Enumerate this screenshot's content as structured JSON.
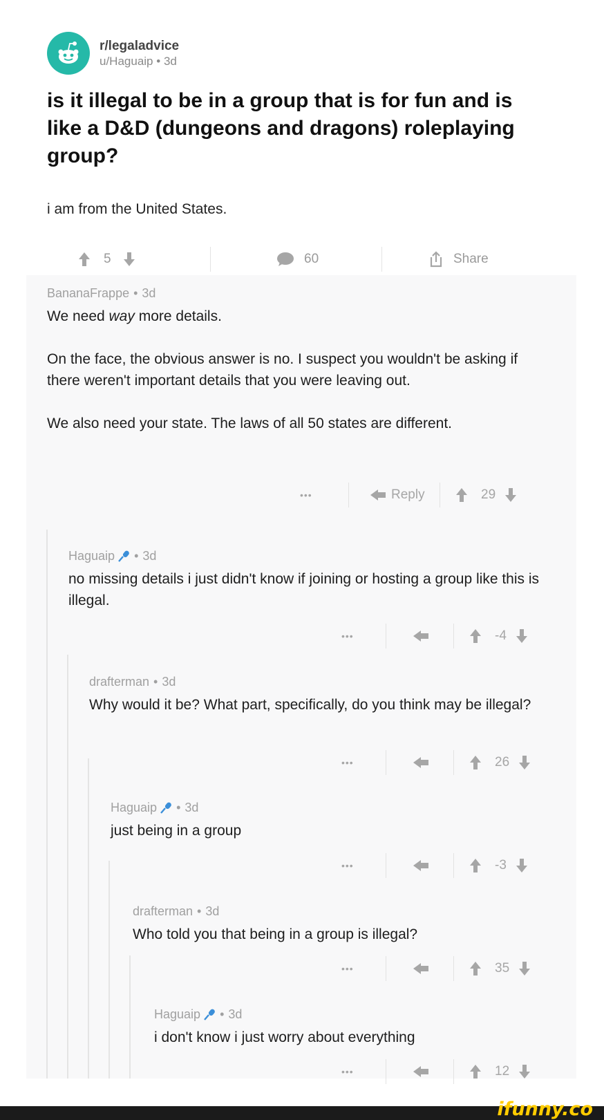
{
  "post": {
    "subreddit": "r/legaladvice",
    "user": "u/Haguaip",
    "age": "3d",
    "title": "is it illegal to be in a group that is for fun and is like a D&D (dungeons and dragons) roleplaying group?",
    "body": "i am from the United States.",
    "votes": "5",
    "comments": "60",
    "share_label": "Share"
  },
  "comments": [
    {
      "author": "BananaFrappe",
      "age": "3d",
      "paragraphs": [
        [
          "We need ",
          "way",
          " more details."
        ],
        "On the face, the obvious answer is no. I suspect you wouldn't be asking if there weren't important details that you were leaving out.",
        "We also need your state. The laws of all 50 states are different."
      ],
      "reply_label": "Reply",
      "score": "29"
    },
    {
      "author": "Haguaip",
      "age": "3d",
      "text": "no missing details i just didn't know if joining or hosting a group like this is illegal.",
      "score": "-4"
    },
    {
      "author": "drafterman",
      "age": "3d",
      "text": "Why would it be? What part, specifically, do you think may be illegal?",
      "score": "26"
    },
    {
      "author": "Haguaip",
      "age": "3d",
      "text": "just being in a group",
      "score": "-3"
    },
    {
      "author": "drafterman",
      "age": "3d",
      "text": "Who told you that being in a group is illegal?",
      "score": "35"
    },
    {
      "author": "Haguaip",
      "age": "3d",
      "text": "i don't know i just worry about everything",
      "score": "12"
    }
  ],
  "ui": {
    "more_dots": "•••",
    "dot": "•"
  },
  "watermark": "ifunny.co",
  "colors": {
    "avatar_teal": "#25b9a8",
    "mic_blue": "#3b8fd9",
    "watermark_yellow": "#ffcc00"
  },
  "icons": [
    "reddit-alien-icon",
    "upvote-icon",
    "downvote-icon",
    "comment-bubble-icon",
    "share-icon",
    "reply-arrow-icon",
    "microphone-icon",
    "more-options-icon"
  ]
}
